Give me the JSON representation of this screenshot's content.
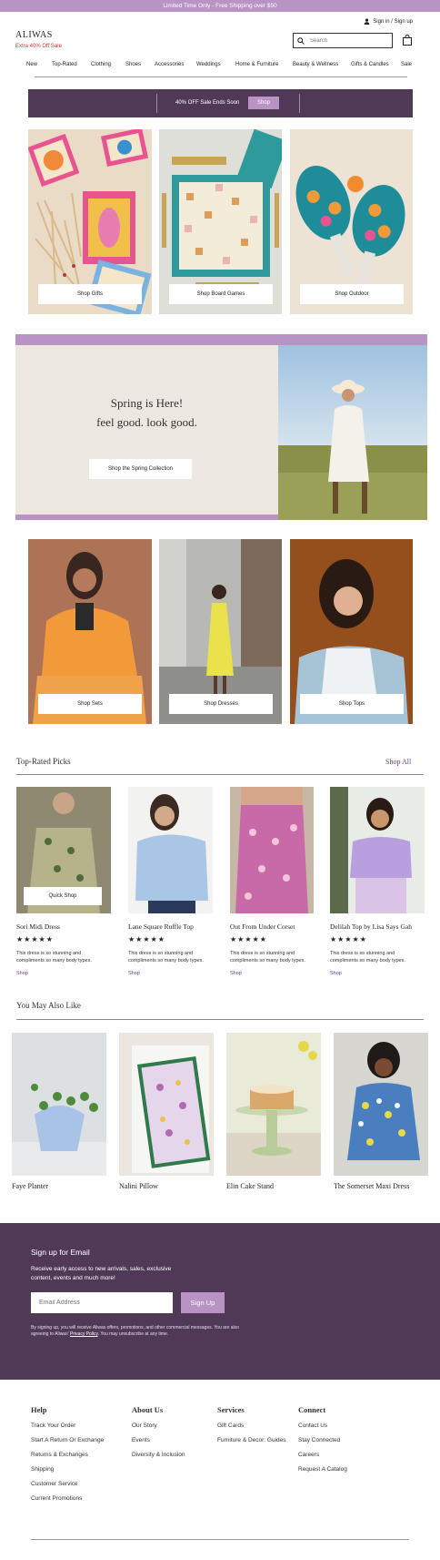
{
  "promo": "Limited Time Only - Free Shipping over $50",
  "header": {
    "logo": "ALIWAS",
    "extra": "Extra 40% Off Sale",
    "signin": "Sign in / Sign up",
    "search_placeholder": "Search"
  },
  "nav": [
    "New",
    "Top-Rated",
    "Clothing",
    "Shoes",
    "Accessories",
    "Weddings",
    "Home & Furniture",
    "Beauty & Wellness",
    "Gifts & Candles",
    "Sale"
  ],
  "salebar": {
    "text": "40% OFF Sale Ends Soon",
    "button": "Shop"
  },
  "category_tiles": [
    {
      "label": "Shop Gifts"
    },
    {
      "label": "Shop Board Games"
    },
    {
      "label": "Shop Outdoor"
    }
  ],
  "spring": {
    "line1": "Spring is Here!",
    "line2": "feel good. look good.",
    "button": "Shop the Spring Collection"
  },
  "fashion_tiles": [
    {
      "label": "Shop Sets"
    },
    {
      "label": "Shop Dresses"
    },
    {
      "label": "Shop Tops"
    }
  ],
  "top_rated": {
    "title": "Top-Rated Picks",
    "shop_all": "Shop All",
    "quick_shop": "Quick Shop",
    "stars": "★★★★★",
    "products": [
      {
        "name": "Sori Midi Dress",
        "desc": "This dress is so stunning and compliments so many body types.",
        "link": "Shop"
      },
      {
        "name": "Lane Square Ruffle Top",
        "desc": "This dress is so stunning and compliments so many body types.",
        "link": "Shop"
      },
      {
        "name": "Out From Under Corset",
        "desc": "This dress is so stunning and compliments so many body types.",
        "link": "Shop"
      },
      {
        "name": "Delilah Top by Lisa Says Gah",
        "desc": "This dress is so stunning and compliments so many body types.",
        "link": "Shop"
      }
    ]
  },
  "also_like": {
    "title": "You May Also Like",
    "items": [
      {
        "name": "Faye Planter"
      },
      {
        "name": "Nalini Pillow"
      },
      {
        "name": "Elin Cake Stand"
      },
      {
        "name": "The Somerset Maxi Dress"
      }
    ]
  },
  "email": {
    "title": "Sign up for Email",
    "text": "Receive early access to new arrivals, sales, exclusive content, events and much more!",
    "placeholder": "Email Address",
    "button": "Sign Up",
    "legal": "By signing up, you will receive Aliwas offers, promotions, and other commercial messages. You are also agreeing to Aliwas'",
    "policy": "Privacy Policy",
    "legal_end": ". You may unsubscribe at any time."
  },
  "footer": {
    "help": {
      "title": "Help",
      "links": [
        "Track Your Order",
        "Start A Return Or Exchange",
        "Returns & Exchanges",
        "Shipping",
        "Customer Service",
        "Current Promotions"
      ]
    },
    "about": {
      "title": "About Us",
      "links": [
        "Our Story",
        "Events",
        "Diversity & Inclusion"
      ]
    },
    "services": {
      "title": "Services",
      "links": [
        "Gift Cards",
        "Furniture & Decor: Guides"
      ]
    },
    "connect": {
      "title": "Connect",
      "links": [
        "Contact Us",
        "Stay Connected",
        "Careers",
        "Request A Catalog"
      ]
    }
  },
  "colors": {
    "accent": "#b893c4",
    "dark": "#4f3957",
    "link": "#6a3d84",
    "sale_red": "#d0342c"
  }
}
